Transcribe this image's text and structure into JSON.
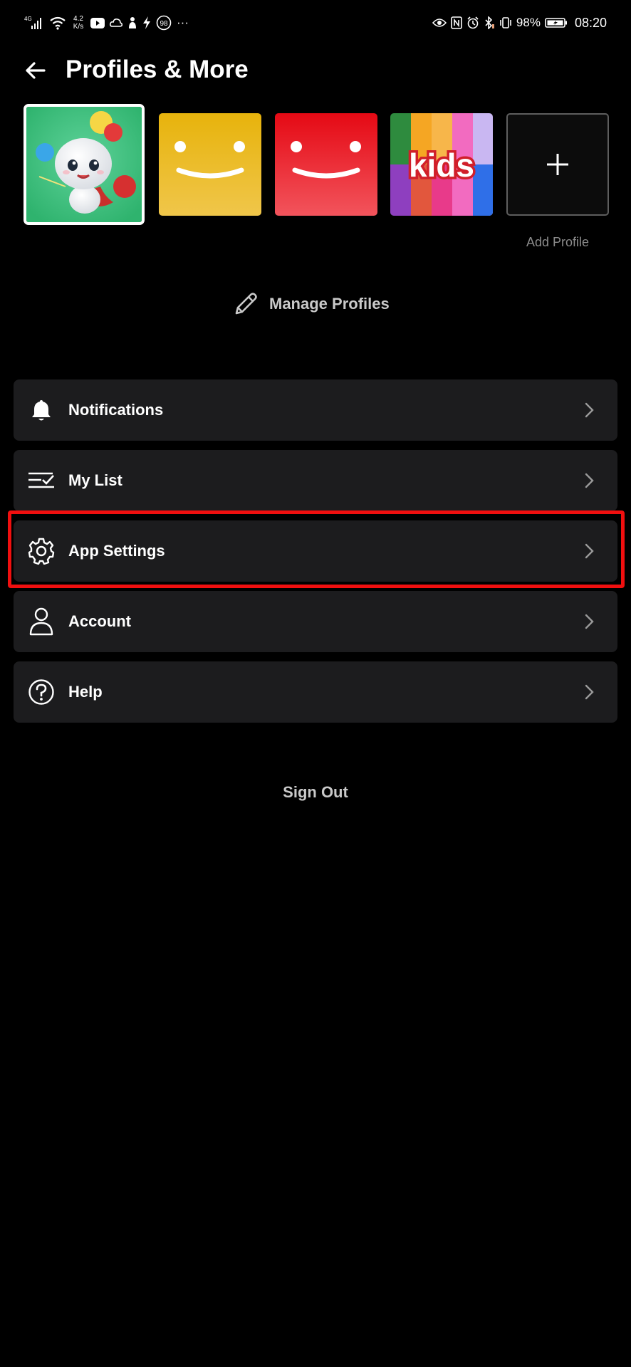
{
  "status_bar": {
    "network": "4G",
    "speed_value": "4.2",
    "speed_unit": "K/s",
    "notification_count": "98",
    "more": "···",
    "battery": "98%",
    "time": "08:20"
  },
  "header": {
    "title": "Profiles & More"
  },
  "profiles": {
    "kids_label": "kids",
    "add_label": "Add Profile",
    "manage_label": "Manage Profiles"
  },
  "menu": {
    "items": [
      {
        "label": "Notifications",
        "icon": "bell-icon"
      },
      {
        "label": "My List",
        "icon": "list-check-icon"
      },
      {
        "label": "App Settings",
        "icon": "gear-icon"
      },
      {
        "label": "Account",
        "icon": "person-icon"
      },
      {
        "label": "Help",
        "icon": "help-circle-icon"
      }
    ]
  },
  "footer": {
    "sign_out": "Sign Out"
  },
  "colors": {
    "background": "#000000",
    "row": "#1c1c1e",
    "highlight": "#f00f0f",
    "muted_text": "#8c8c8c"
  }
}
